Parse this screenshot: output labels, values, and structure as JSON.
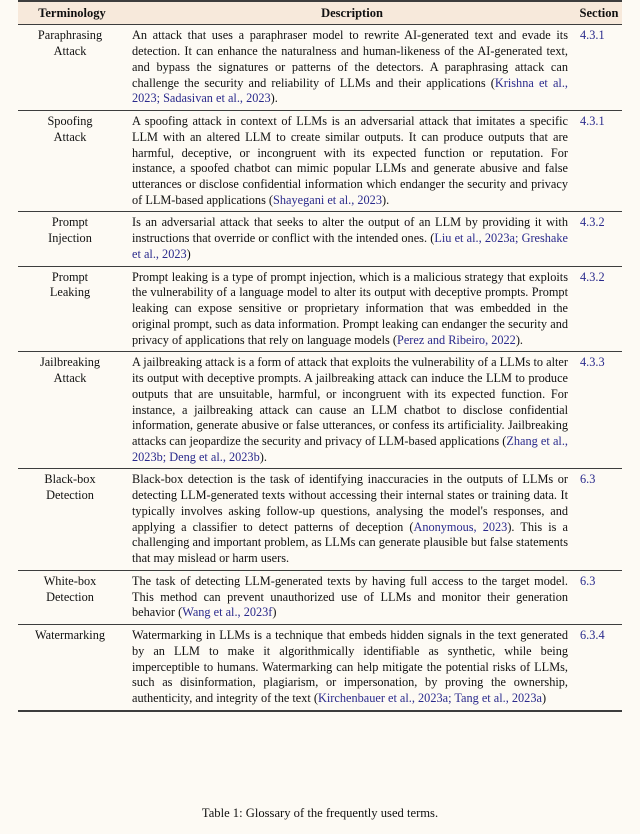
{
  "table": {
    "columns": {
      "terminology": "Terminology",
      "description": "Description",
      "section": "Section"
    },
    "rows": [
      {
        "term": "Paraphrasing\nAttack",
        "description_pre": "An attack that uses a paraphraser model to rewrite AI-generated text and evade its detection. It can enhance the naturalness and human-likeness of the AI-generated text, and bypass the signatures or patterns of the detectors. A paraphrasing attack can challenge the security and reliability of LLMs and their applications (",
        "citation": "Krishna et al., 2023; Sadasivan et al., 2023",
        "description_post": ").",
        "section": "4.3.1"
      },
      {
        "term": "Spoofing\nAttack",
        "description_pre": "A spoofing attack in context of LLMs is an adversarial attack that imitates a specific LLM with an altered LLM to create similar outputs. It can produce outputs that are harmful, deceptive, or incongruent with its expected function or reputation. For instance, a spoofed chatbot can mimic popular LLMs and generate abusive and false utterances or disclose confidential information which endanger the security and privacy of LLM-based applications (",
        "citation": "Shayegani et al., 2023",
        "description_post": ").",
        "section": "4.3.1"
      },
      {
        "term": "Prompt\nInjection",
        "description_pre": "Is an adversarial attack that seeks to alter the output of an LLM by providing it with instructions that override or conflict with the intended ones. (",
        "citation": "Liu et al., 2023a; Greshake et al., 2023",
        "description_post": ")",
        "section": "4.3.2"
      },
      {
        "term": "Prompt\nLeaking",
        "description_pre": "Prompt leaking is a type of prompt injection, which is a malicious strategy that exploits the vulnerability of a language model to alter its output with deceptive prompts. Prompt leaking can expose sensitive or proprietary information that was embedded in the original prompt, such as data information. Prompt leaking can endanger the security and privacy of applications that rely on language models (",
        "citation": "Perez and Ribeiro, 2022",
        "description_post": ").",
        "section": "4.3.2"
      },
      {
        "term": "Jailbreaking\nAttack",
        "description_pre": "A jailbreaking attack is a form of attack that exploits the vulnerability of a LLMs to alter its output with deceptive prompts. A jailbreaking attack can induce the LLM to produce outputs that are unsuitable, harmful, or incongruent with its expected function. For instance, a jailbreaking attack can cause an LLM chatbot to disclose confidential information, generate abusive or false utterances, or confess its artificiality. Jailbreaking attacks can jeopardize the security and privacy of LLM-based applications (",
        "citation": "Zhang et al., 2023b; Deng et al., 2023b",
        "description_post": ").",
        "section": "4.3.3"
      },
      {
        "term": "Black-box\nDetection",
        "description_pre": "Black-box detection is the task of identifying inaccuracies in the outputs of LLMs or detecting LLM-generated texts without accessing their internal states or training data. It typically involves asking follow-up questions, analysing the model's responses, and applying a classifier to detect patterns of deception (",
        "citation": "Anonymous, 2023",
        "description_post": "). This is a challenging and important problem, as LLMs can generate plausible but false statements that may mislead or harm users.",
        "section": "6.3"
      },
      {
        "term": "White-box\nDetection",
        "description_pre": "The task of detecting LLM-generated texts by having full access to the target model. This method can prevent unauthorized use of LLMs and monitor their generation behavior (",
        "citation": "Wang et al., 2023f",
        "description_post": ")",
        "section": "6.3"
      },
      {
        "term": "Watermarking",
        "description_pre": "Watermarking in LLMs is a technique that embeds hidden signals in the text generated by an LLM to make it algorithmically identifiable as synthetic, while being imperceptible to humans. Watermarking can help mitigate the potential risks of LLMs, such as disinformation, plagiarism, or impersonation, by proving the ownership, authenticity, and integrity of the text (",
        "citation": "Kirchenbauer et al., 2023a; Tang et al., 2023a",
        "description_post": ")",
        "section": "6.3.4"
      }
    ]
  },
  "caption": "Table 1: Glossary of the frequently used terms.",
  "colors": {
    "citation": "#2a2a8c",
    "header_background": "#f7e9db",
    "page_background": "#fdfaf4",
    "rule": "#3d3d3d"
  }
}
